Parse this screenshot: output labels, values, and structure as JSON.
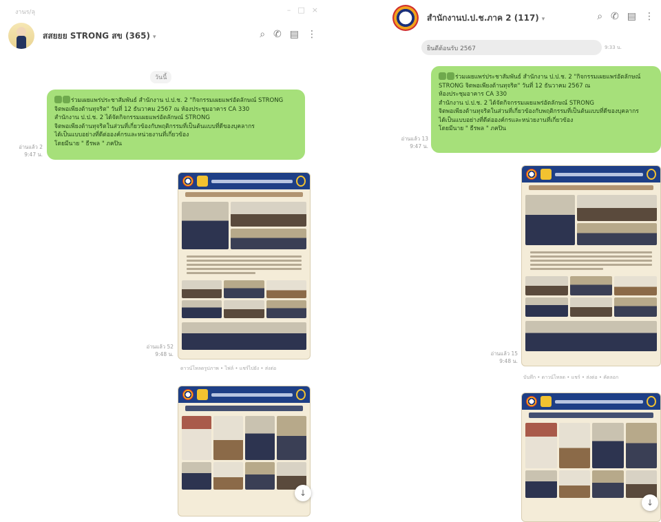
{
  "left_chat": {
    "corner_label": "งานร/ลุ",
    "window_controls": [
      "–",
      "□",
      "×"
    ],
    "title": "สสยยย STRONG สข (365)",
    "date_divider": "วันนี้",
    "message_text": [
      "ร่วมเผยแพร่ประชาสัมพันธ์ สำนักงาน ป.ป.ช. 2 \"กิจกรรมเผยแพร่อัตลักษณ์ STRONG",
      "จิตพอเพียงต้านทุจริต\" วันที่ 12 ธันวาคม 2567 ณ ห้องประชุมอาคาร CA 330",
      "สำนักงาน ป.ป.ช. 2 ได้จัดกิจกรรมเผยแพร่อัตลักษณ์ STRONG",
      "จิตพอเพียงต้านทุจริตในส่วนที่เกี่ยวข้องกับพฤติกรรมที่เป็นต้นแบบที่ดีของบุคลากร",
      "ได้เป็นแบบอย่างที่ดีต่อองค์กรและหน่วยงานที่เกี่ยวข้อง",
      "โดยมีนาย \" ธีรพล \" ภคปิน"
    ],
    "message_meta": [
      "อ่านแล้ว 2",
      "9:47 น."
    ],
    "photo_meta": [
      "อ่านแล้ว 52",
      "9:48 น."
    ],
    "photo_caption": "ดาวน์โหลดรูปภาพ • ไฟล์ • แชร์ไปยัง • ส่งต่อ",
    "scroll_down": "↓"
  },
  "right_chat": {
    "title": "สำนักงานป.ป.ช.ภาค 2 (117)",
    "window_controls": [
      "–",
      "×"
    ],
    "previous_message": "ยินดีต้อนรับ 2567",
    "previous_time": "9:33 น.",
    "message_text": [
      "ร่วมเผยแพร่ประชาสัมพันธ์ สำนักงาน ป.ป.ช. 2 \"กิจกรรมเผยแพร่อัตลักษณ์",
      "STRONG จิตพอเพียงต้านทุจริต\" วันที่ 12 ธันวาคม 2567 ณ",
      "ห้องประชุมอาคาร CA 330",
      "สำนักงาน ป.ป.ช. 2 ได้จัดกิจกรรมเผยแพร่อัตลักษณ์ STRONG",
      "จิตพอเพียงต้านทุจริตในส่วนที่เกี่ยวข้องกับพฤติกรรมที่เป็นต้นแบบที่ดีของบุคลากร",
      "ได้เป็นแบบอย่างที่ดีต่อองค์กรและหน่วยงานที่เกี่ยวข้อง",
      "โดยมีนาย \" ธีรพล \" ภคปิน"
    ],
    "message_meta": [
      "อ่านแล้ว 13",
      "9:47 น."
    ],
    "photo_meta": [
      "อ่านแล้ว 15",
      "9:48 น."
    ],
    "photo_caption": "บันทึก • ดาวน์โหลด • แชร์ • ส่งต่อ • คัดลอก",
    "scroll_down": "↓"
  }
}
